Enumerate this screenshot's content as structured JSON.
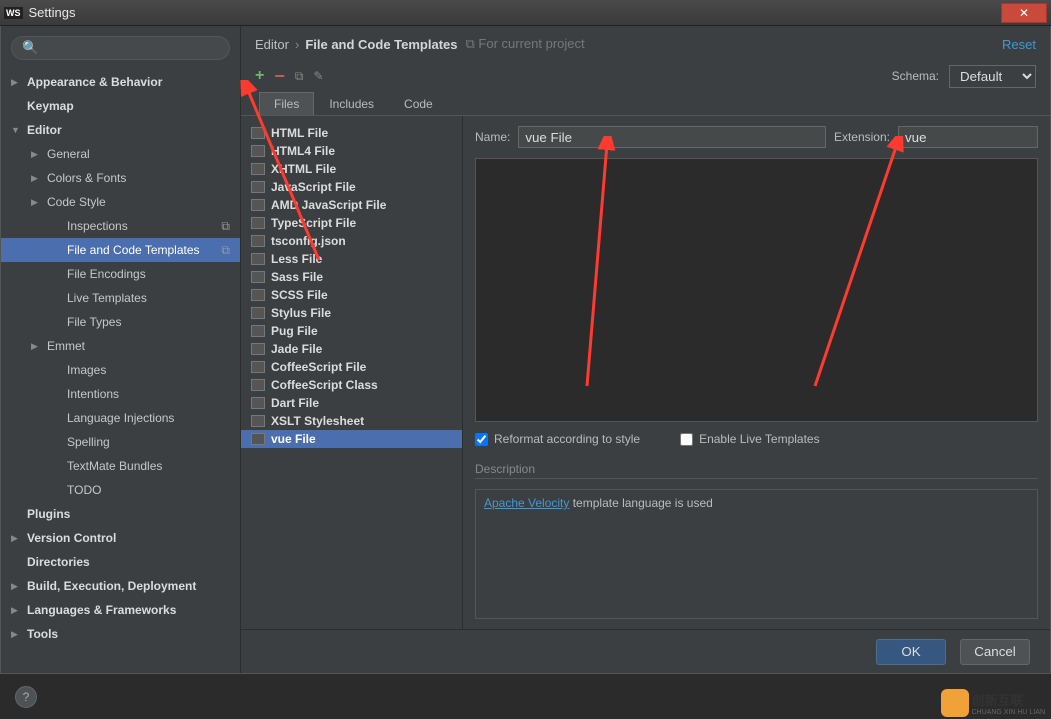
{
  "window": {
    "title": "Settings"
  },
  "sidebar": {
    "search_placeholder": "",
    "items": [
      {
        "label": "Appearance & Behavior",
        "bold": true,
        "chev": "▶",
        "indent": 0
      },
      {
        "label": "Keymap",
        "bold": true,
        "indent": 0
      },
      {
        "label": "Editor",
        "bold": true,
        "chev": "▼",
        "indent": 0
      },
      {
        "label": "General",
        "chev": "▶",
        "indent": 1
      },
      {
        "label": "Colors & Fonts",
        "chev": "▶",
        "indent": 1
      },
      {
        "label": "Code Style",
        "chev": "▶",
        "indent": 1
      },
      {
        "label": "Inspections",
        "indent": 2,
        "badge": "⧉"
      },
      {
        "label": "File and Code Templates",
        "indent": 2,
        "selected": true,
        "badge": "⧉"
      },
      {
        "label": "File Encodings",
        "indent": 2
      },
      {
        "label": "Live Templates",
        "indent": 2
      },
      {
        "label": "File Types",
        "indent": 2
      },
      {
        "label": "Emmet",
        "chev": "▶",
        "indent": 1
      },
      {
        "label": "Images",
        "indent": 2
      },
      {
        "label": "Intentions",
        "indent": 2
      },
      {
        "label": "Language Injections",
        "indent": 2
      },
      {
        "label": "Spelling",
        "indent": 2
      },
      {
        "label": "TextMate Bundles",
        "indent": 2
      },
      {
        "label": "TODO",
        "indent": 2
      },
      {
        "label": "Plugins",
        "bold": true,
        "indent": 0
      },
      {
        "label": "Version Control",
        "bold": true,
        "chev": "▶",
        "indent": 0
      },
      {
        "label": "Directories",
        "bold": true,
        "indent": 0
      },
      {
        "label": "Build, Execution, Deployment",
        "bold": true,
        "chev": "▶",
        "indent": 0
      },
      {
        "label": "Languages & Frameworks",
        "bold": true,
        "chev": "▶",
        "indent": 0
      },
      {
        "label": "Tools",
        "bold": true,
        "chev": "▶",
        "indent": 0
      }
    ]
  },
  "breadcrumb": {
    "parent": "Editor",
    "current": "File and Code Templates",
    "scope": "For current project"
  },
  "reset_label": "Reset",
  "schema": {
    "label": "Schema:",
    "value": "Default"
  },
  "tabs": [
    "Files",
    "Includes",
    "Code"
  ],
  "active_tab": 0,
  "templates": [
    "HTML File",
    "HTML4 File",
    "XHTML File",
    "JavaScript File",
    "AMD JavaScript File",
    "TypeScript File",
    "tsconfig.json",
    "Less File",
    "Sass File",
    "SCSS File",
    "Stylus File",
    "Pug File",
    "Jade File",
    "CoffeeScript File",
    "CoffeeScript Class",
    "Dart File",
    "XSLT Stylesheet",
    "vue File"
  ],
  "selected_template": "vue File",
  "form": {
    "name_label": "Name:",
    "name_value": "vue File",
    "ext_label": "Extension:",
    "ext_value": "vue",
    "reformat_label": "Reformat according to style",
    "reformat_checked": true,
    "live_label": "Enable Live Templates",
    "live_checked": false,
    "desc_label": "Description",
    "desc_link": "Apache Velocity",
    "desc_rest": " template language is used"
  },
  "buttons": {
    "ok": "OK",
    "cancel": "Cancel"
  },
  "watermark": {
    "cn": "创新互联",
    "en": "CHUANG XIN HU LIAN"
  }
}
